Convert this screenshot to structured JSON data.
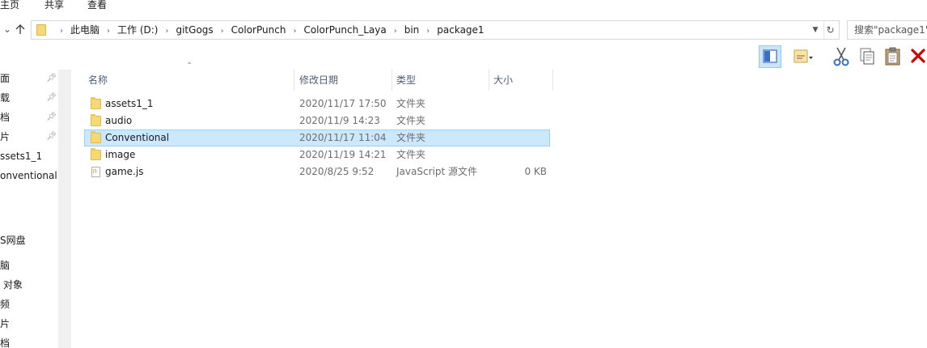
{
  "ribbon": {
    "tabs": [
      {
        "label": "主页"
      },
      {
        "label": "共享"
      },
      {
        "label": "查看"
      }
    ]
  },
  "address": {
    "crumbs": [
      "此电脑",
      "工作 (D:)",
      "gitGogs",
      "ColorPunch",
      "ColorPunch_Laya",
      "bin",
      "package1"
    ]
  },
  "search": {
    "placeholder": "搜索\"package1\""
  },
  "toolbar": {
    "icons": [
      "preview-pane-icon",
      "properties-icon",
      "cut-icon",
      "copy-icon",
      "paste-icon",
      "delete-icon"
    ],
    "delete_color": "#d20000",
    "cut_color": "#3a6fc4"
  },
  "nav": {
    "items": [
      {
        "label": "面",
        "pinned": true
      },
      {
        "label": "载",
        "pinned": true
      },
      {
        "label": "档",
        "pinned": true
      },
      {
        "label": "片",
        "pinned": true
      },
      {
        "label": "ssets1_1",
        "pinned": false
      },
      {
        "label": "onventional",
        "pinned": false
      },
      {
        "label": "S网盘",
        "pinned": false
      },
      {
        "label": "脑",
        "pinned": false
      },
      {
        "label": "对象",
        "pinned": false
      },
      {
        "label": "频",
        "pinned": false
      },
      {
        "label": "片",
        "pinned": false
      },
      {
        "label": "档",
        "pinned": false
      }
    ]
  },
  "columns": {
    "name": "名称",
    "date": "修改日期",
    "type": "类型",
    "size": "大小"
  },
  "files": [
    {
      "name": "assets1_1",
      "date": "2020/11/17 17:50",
      "type": "文件夹",
      "size": "",
      "kind": "folder",
      "selected": false
    },
    {
      "name": "audio",
      "date": "2020/11/9 14:23",
      "type": "文件夹",
      "size": "",
      "kind": "folder",
      "selected": false
    },
    {
      "name": "Conventional",
      "date": "2020/11/17 11:04",
      "type": "文件夹",
      "size": "",
      "kind": "folder",
      "selected": true
    },
    {
      "name": "image",
      "date": "2020/11/19 14:21",
      "type": "文件夹",
      "size": "",
      "kind": "folder",
      "selected": false
    },
    {
      "name": "game.js",
      "date": "2020/8/25 9:52",
      "type": "JavaScript 源文件",
      "size": "0 KB",
      "kind": "js",
      "selected": false
    }
  ],
  "colors": {
    "selection_bg": "#cce8ff",
    "selection_border": "#99d1ff",
    "folder": "#f8d775"
  }
}
